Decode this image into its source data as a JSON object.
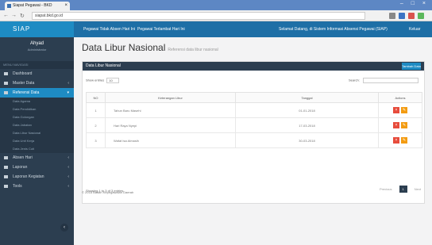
{
  "browser": {
    "tab_title": "Siapat Pegawai - BKD",
    "tab_close": "×",
    "url": "siapat.bkd.go.id",
    "window_controls": "– □ ×"
  },
  "sidebar": {
    "brand": "SIAP",
    "user_name": "Ahyad",
    "user_role": "Administrator",
    "menu_header": "MENU NAVIGASI",
    "items": [
      {
        "label": "Dashboard",
        "icon": "dashboard-icon",
        "active": false
      },
      {
        "label": "Master Data",
        "icon": "folder-icon",
        "active": false
      },
      {
        "label": "Referensi Data",
        "icon": "list-icon",
        "active": true
      }
    ],
    "subitems": [
      "Data Agama",
      "Data Pendidikan",
      "Data Golongan",
      "Data Jabatan",
      "Data Libur Nasional",
      "Data Unit Kerja",
      "Data Jenis Cuti"
    ],
    "items2": [
      {
        "label": "Absen Hari",
        "icon": "calendar-icon"
      },
      {
        "label": "Laporan",
        "icon": "report-icon"
      },
      {
        "label": "Laporan Kegiatan",
        "icon": "chart-icon"
      },
      {
        "label": "Tools",
        "icon": "tools-icon"
      }
    ]
  },
  "topbar": {
    "left1": "Pegawai Tidak Absen Hari Ini",
    "left2": "Pegawai Terlambat Hari Ini",
    "right1": "Selamat Datang, di Sistem Informasi Absensi Pegawai (SIAP)",
    "right2": "Keluar"
  },
  "page": {
    "title": "Data Libur Nasional",
    "subtitle": "Referensi data libur nasional"
  },
  "panel": {
    "header": "Data Libur Nasional",
    "add_label": "Tambah Data",
    "show_label": "Show entries",
    "entries_value": "10",
    "search_label": "Search:",
    "columns": [
      "NO",
      "Keterangan Libur",
      "Tanggal",
      "Actions"
    ],
    "rows": [
      {
        "no": "1",
        "name": "Tahun Baru Masehi",
        "date": "01-01-2018"
      },
      {
        "no": "2",
        "name": "Hari Raya Nyepi",
        "date": "17-03-2018"
      },
      {
        "no": "3",
        "name": "Wafat Isa Almasih",
        "date": "30-03-2018"
      }
    ],
    "info": "Showing 1 to 3 of 3 entries",
    "prev_label": "Previous",
    "current_page": "1",
    "next_label": "Next"
  },
  "footer": "© 2018 Badan Kepegawaian Daerah",
  "colors": {
    "accent": "#1e8bc3",
    "sidebar": "#2c3e50",
    "delete": "#e74c3c",
    "edit": "#f39c12"
  }
}
